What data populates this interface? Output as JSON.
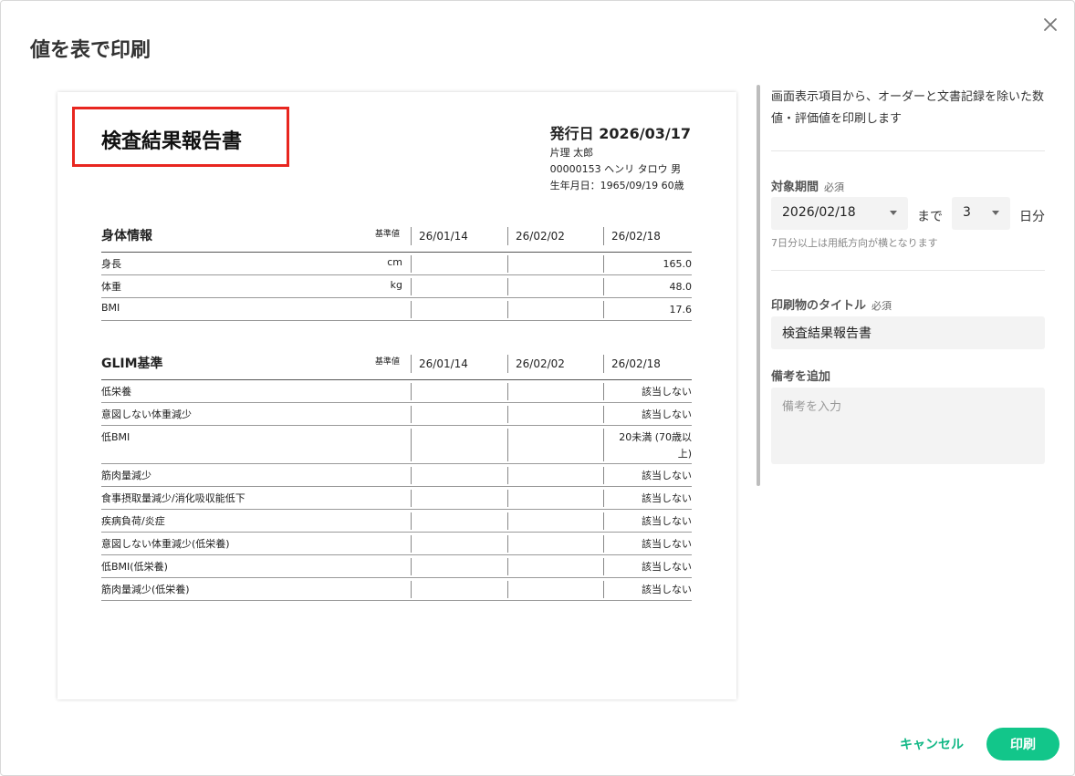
{
  "modal": {
    "title": "値を表で印刷",
    "close_icon": "close-icon"
  },
  "preview": {
    "doc_title": "検査結果報告書",
    "issue_date": "発行日 2026/03/17",
    "issuer": "片理 太郎",
    "patient": "00000153 ヘンリ タロウ 男",
    "birth": "生年月日：1965/09/19 60歳",
    "dates": [
      "26/01/14",
      "26/02/02",
      "26/02/18"
    ],
    "sections": [
      {
        "name": "身体情報",
        "std_label": "基準値",
        "rows": [
          {
            "label": "身長",
            "unit": "cm",
            "value": "165.0"
          },
          {
            "label": "体重",
            "unit": "kg",
            "value": "48.0"
          },
          {
            "label": "BMI",
            "unit": "",
            "value": "17.6"
          }
        ]
      },
      {
        "name": "GLIM基準",
        "std_label": "基準値",
        "rows": [
          {
            "label": "低栄養",
            "unit": "",
            "value": "該当しない"
          },
          {
            "label": "意図しない体重減少",
            "unit": "",
            "value": "該当しない"
          },
          {
            "label": "低BMI",
            "unit": "",
            "value": "20未満 (70歳以上)"
          },
          {
            "label": "筋肉量減少",
            "unit": "",
            "value": "該当しない"
          },
          {
            "label": "食事摂取量減少/消化吸収能低下",
            "unit": "",
            "value": "該当しない"
          },
          {
            "label": "疾病負荷/炎症",
            "unit": "",
            "value": "該当しない"
          },
          {
            "label": "意図しない体重減少(低栄養)",
            "unit": "",
            "value": "該当しない"
          },
          {
            "label": "低BMI(低栄養)",
            "unit": "",
            "value": "該当しない"
          },
          {
            "label": "筋肉量減少(低栄養)",
            "unit": "",
            "value": "該当しない"
          }
        ]
      }
    ]
  },
  "side": {
    "description": "画面表示項目から、オーダーと文書記録を除いた数値・評価値を印刷します",
    "period_label": "対象期間",
    "required": "必須",
    "period_date": "2026/02/18",
    "until": "まで",
    "days_value": "3",
    "days_unit": "日分",
    "hint": "7日分以上は用紙方向が横となります",
    "title_label": "印刷物のタイトル",
    "title_value": "検査結果報告書",
    "note_label": "備考を追加",
    "note_placeholder": "備考を入力"
  },
  "footer": {
    "cancel": "キャンセル",
    "print": "印刷"
  },
  "colors": {
    "accent": "#12c68a",
    "highlight": "#e8261f"
  }
}
